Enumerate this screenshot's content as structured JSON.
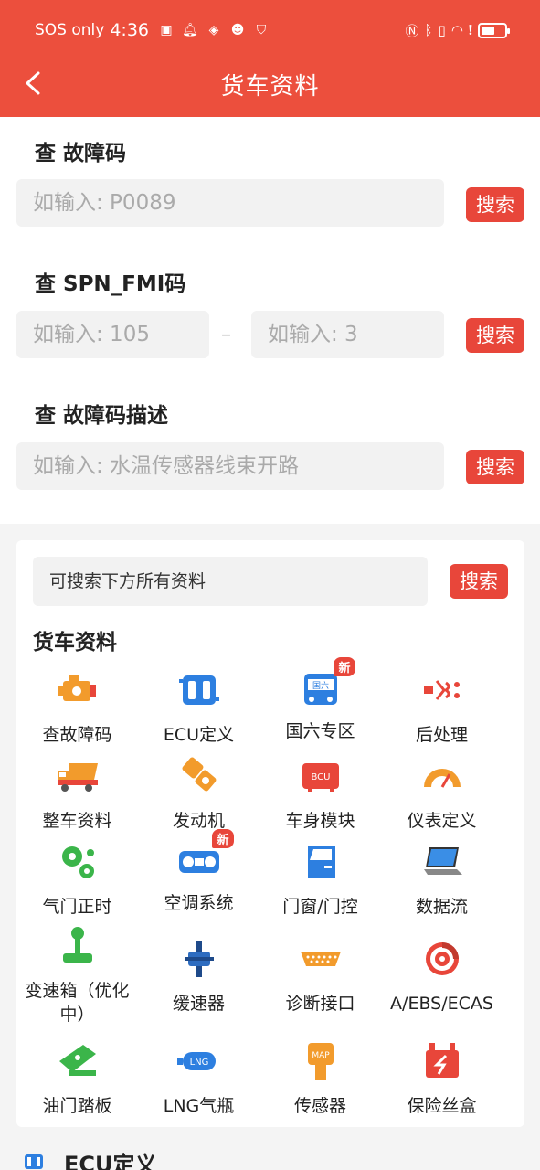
{
  "status_bar": {
    "carrier": "SOS only",
    "time": "4:36"
  },
  "header": {
    "title": "货车资料"
  },
  "search_sections": [
    {
      "title": "查 故障码",
      "placeholder": "如输入: P0089",
      "button": "搜索"
    },
    {
      "title": "查 SPN_FMI码",
      "placeholder_spn": "如输入: 105",
      "separator": "–",
      "placeholder_fmi": "如输入: 3",
      "button": "搜索"
    },
    {
      "title": "查 故障码描述",
      "placeholder": "如输入: 水温传感器线束开路",
      "button": "搜索"
    }
  ],
  "all_search": {
    "placeholder": "可搜索下方所有资料",
    "button": "搜索"
  },
  "truck_info": {
    "title": "货车资料",
    "items": [
      {
        "label": "查故障码",
        "icon": "engine-icon"
      },
      {
        "label": "ECU定义",
        "icon": "ecu-icon"
      },
      {
        "label": "国六专区",
        "icon": "bus-icon",
        "badge": "新"
      },
      {
        "label": "后处理",
        "icon": "exhaust-icon"
      },
      {
        "label": "整车资料",
        "icon": "dump-truck-icon"
      },
      {
        "label": "发动机",
        "icon": "engine-part-icon"
      },
      {
        "label": "车身模块",
        "icon": "bcu-icon"
      },
      {
        "label": "仪表定义",
        "icon": "gauge-icon"
      },
      {
        "label": "气门正时",
        "icon": "gears-icon"
      },
      {
        "label": "空调系统",
        "icon": "ac-panel-icon",
        "badge": "新"
      },
      {
        "label": "门窗/门控",
        "icon": "door-icon"
      },
      {
        "label": "数据流",
        "icon": "laptop-icon"
      },
      {
        "label": "变速箱（优化中）",
        "icon": "gear-shift-icon"
      },
      {
        "label": "缓速器",
        "icon": "retarder-icon"
      },
      {
        "label": "诊断接口",
        "icon": "obd-port-icon"
      },
      {
        "label": "A/EBS/ECAS",
        "icon": "brake-disc-icon"
      },
      {
        "label": "油门踏板",
        "icon": "pedal-icon"
      },
      {
        "label": "LNG气瓶",
        "icon": "lng-tank-icon"
      },
      {
        "label": "传感器",
        "icon": "map-sensor-icon"
      },
      {
        "label": "保险丝盒",
        "icon": "fuse-box-icon"
      }
    ]
  },
  "next_section": {
    "title": "ECU定义"
  },
  "colors": {
    "accent": "#ec4f3d",
    "button": "#e8463a",
    "orange": "#f29b2c",
    "blue": "#2d7fe0",
    "green": "#3bb54a"
  }
}
